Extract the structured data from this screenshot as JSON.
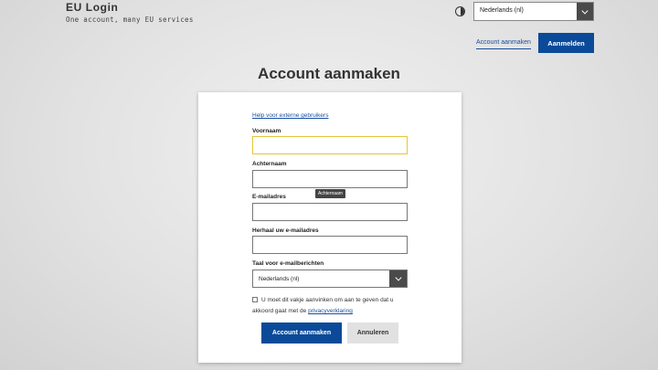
{
  "header": {
    "title": "EU Login",
    "subtitle": "One account, many EU services",
    "language": "Nederlands (nl)",
    "create_account_link": "Account aanmaken",
    "login_button": "Aanmelden"
  },
  "page": {
    "title": "Account aanmaken"
  },
  "form": {
    "help_link": "Help voor externe gebruikers",
    "first_name_label": "Voornaam",
    "first_name_value": "",
    "last_name_label": "Achternaam",
    "last_name_value": "",
    "tooltip": "Achternaam",
    "email_label": "E-mailadres",
    "email_value": "",
    "email_confirm_label": "Herhaal uw e-mailadres",
    "email_confirm_value": "",
    "email_language_label": "Taal voor e-mailberichten",
    "email_language_value": "Nederlands (nl)",
    "consent_text": "U moet dit vakje aanvinken om aan te geven dat u akkoord gaat met de",
    "privacy_link": "privacyverklaring",
    "submit_button": "Account aanmaken",
    "cancel_button": "Annuleren"
  },
  "colors": {
    "primary": "#0b4a99",
    "link": "#1a4fa0",
    "focus": "#e6c43a"
  }
}
